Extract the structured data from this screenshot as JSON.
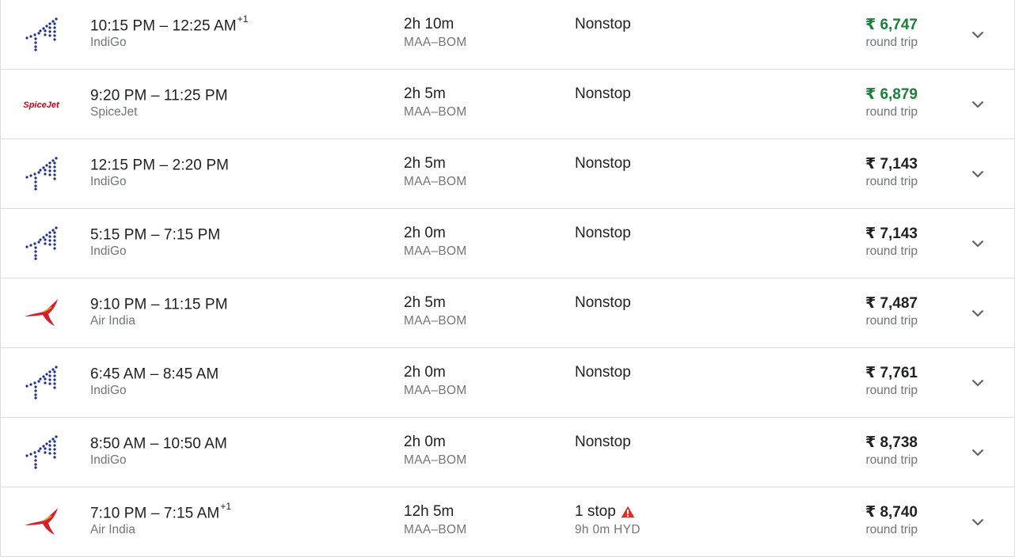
{
  "flights": [
    {
      "logo": "indigo-logo",
      "departure": "10:15 PM",
      "arrival": "12:25 AM",
      "day_offset": "+1",
      "airline": "IndiGo",
      "duration": "2h 10m",
      "route": "MAA–BOM",
      "stops": "Nonstop",
      "stop_detail": "",
      "price": "₹ 6,747",
      "price_note": "round trip",
      "cheap": true
    },
    {
      "logo": "spicejet-logo",
      "departure": "9:20 PM",
      "arrival": "11:25 PM",
      "day_offset": "",
      "airline": "SpiceJet",
      "duration": "2h 5m",
      "route": "MAA–BOM",
      "stops": "Nonstop",
      "stop_detail": "",
      "price": "₹ 6,879",
      "price_note": "round trip",
      "cheap": true
    },
    {
      "logo": "indigo-logo",
      "departure": "12:15 PM",
      "arrival": "2:20 PM",
      "day_offset": "",
      "airline": "IndiGo",
      "duration": "2h 5m",
      "route": "MAA–BOM",
      "stops": "Nonstop",
      "stop_detail": "",
      "price": "₹ 7,143",
      "price_note": "round trip",
      "cheap": false
    },
    {
      "logo": "indigo-logo",
      "departure": "5:15 PM",
      "arrival": "7:15 PM",
      "day_offset": "",
      "airline": "IndiGo",
      "duration": "2h 0m",
      "route": "MAA–BOM",
      "stops": "Nonstop",
      "stop_detail": "",
      "price": "₹ 7,143",
      "price_note": "round trip",
      "cheap": false
    },
    {
      "logo": "air-india-logo",
      "departure": "9:10 PM",
      "arrival": "11:15 PM",
      "day_offset": "",
      "airline": "Air India",
      "duration": "2h 5m",
      "route": "MAA–BOM",
      "stops": "Nonstop",
      "stop_detail": "",
      "price": "₹ 7,487",
      "price_note": "round trip",
      "cheap": false
    },
    {
      "logo": "indigo-logo",
      "departure": "6:45 AM",
      "arrival": "8:45 AM",
      "day_offset": "",
      "airline": "IndiGo",
      "duration": "2h 0m",
      "route": "MAA–BOM",
      "stops": "Nonstop",
      "stop_detail": "",
      "price": "₹ 7,761",
      "price_note": "round trip",
      "cheap": false
    },
    {
      "logo": "indigo-logo",
      "departure": "8:50 AM",
      "arrival": "10:50 AM",
      "day_offset": "",
      "airline": "IndiGo",
      "duration": "2h 0m",
      "route": "MAA–BOM",
      "stops": "Nonstop",
      "stop_detail": "",
      "price": "₹ 8,738",
      "price_note": "round trip",
      "cheap": false
    },
    {
      "logo": "air-india-logo",
      "departure": "7:10 PM",
      "arrival": "7:15 AM",
      "day_offset": "+1",
      "airline": "Air India",
      "duration": "12h 5m",
      "route": "MAA–BOM",
      "stops": "1 stop",
      "stop_detail": "9h 0m HYD",
      "price": "₹ 8,740",
      "price_note": "round trip",
      "cheap": false,
      "warning_icon": "warning-icon"
    }
  ],
  "time_separator": " – ",
  "colors": {
    "cheap_price": "#188038",
    "indigo_blue": "#1c2f8f",
    "spicejet_red": "#d0021b",
    "air_india_red": "#d3202f",
    "warning_red": "#d93025"
  },
  "icons": {
    "expand": "chevron-down-icon"
  }
}
